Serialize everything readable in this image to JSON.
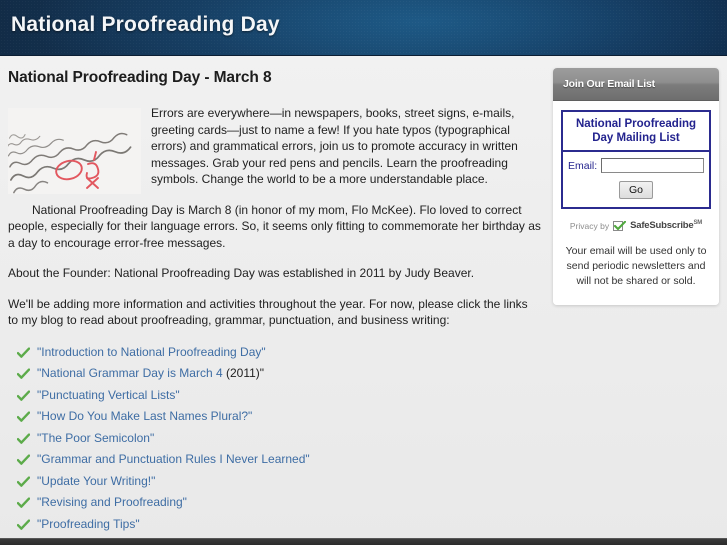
{
  "header": {
    "site_title": "National Proofreading Day",
    "bg_dark": "#122c47",
    "bg_light": "#1e5a87"
  },
  "main": {
    "page_title": "National Proofreading Day - March 8",
    "image_alt": "proofread-manuscript-photo",
    "paragraphs": [
      "Errors are everywhere—in newspapers, books, street signs, e-mails, greeting cards—just to name a few! If you hate typos (typographical errors) and grammatical errors, join us to promote accuracy in written messages. Grab your red pens and pencils. Learn the proofreading symbols. Change the world to be a more understandable place.",
      "National Proofreading Day is March 8 (in honor of my mom, Flo McKee). Flo loved to correct people, especially for their language errors. So, it seems only fitting to commemorate her birthday as a day to encourage error-free messages.",
      "About the Founder: National Proofreading Day was established in 2011 by Judy Beaver.",
      "We'll be adding more information and activities throughout the year. For now, please click the links to my blog to read about proofreading, grammar, punctuation, and business writing:"
    ],
    "link_color": "#3e6da4",
    "links": [
      {
        "label": "\"Introduction to National Proofreading Day\"",
        "suffix": ""
      },
      {
        "label": "\"National Grammar Day is March 4",
        "suffix": " (2011)\""
      },
      {
        "label": "\"Punctuating Vertical Lists\"",
        "suffix": ""
      },
      {
        "label": "\"How Do You Make Last Names Plural?\"",
        "suffix": ""
      },
      {
        "label": "\"The Poor Semicolon\"",
        "suffix": ""
      },
      {
        "label": "\"Grammar and Punctuation Rules I Never Learned\"",
        "suffix": ""
      },
      {
        "label": "\"Update Your Writing!\"",
        "suffix": ""
      },
      {
        "label": "\"Revising and Proofreading\"",
        "suffix": ""
      },
      {
        "label": "\"Proofreading Tips\"",
        "suffix": ""
      }
    ]
  },
  "sidebar": {
    "header_title": "Join Our Email List",
    "form": {
      "title": "National Proofreading Day Mailing List",
      "email_label": "Email:",
      "email_value": "",
      "email_placeholder": "",
      "submit_label": "Go"
    },
    "privacy": {
      "prefix": "Privacy by",
      "brand": "SafeSubscribe",
      "superscript": "SM",
      "note": "Your email will be used only to send periodic newsletters and will not be shared or sold."
    },
    "accent_color": "#23238e"
  }
}
